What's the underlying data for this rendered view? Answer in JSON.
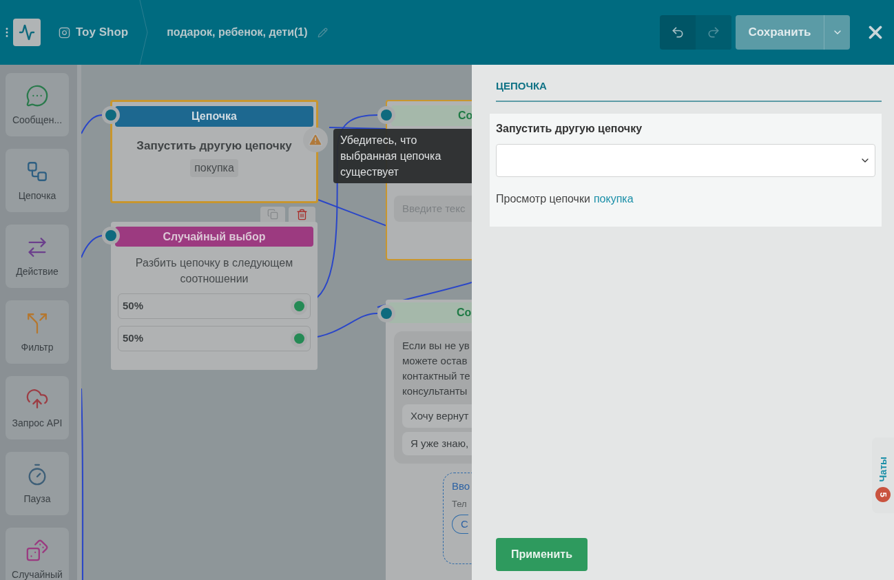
{
  "header": {
    "account": "Toy Shop",
    "flow_title": "подарок, ребенок, дети(1)",
    "save_label": "Сохранить"
  },
  "palette": [
    {
      "label": "Сообщен...",
      "kind": "message"
    },
    {
      "label": "Цепочка",
      "kind": "chain"
    },
    {
      "label": "Действие",
      "kind": "action"
    },
    {
      "label": "Фильтр",
      "kind": "filter"
    },
    {
      "label": "Запрос API",
      "kind": "api"
    },
    {
      "label": "Пауза",
      "kind": "pause"
    },
    {
      "label": "Случайный",
      "kind": "random"
    }
  ],
  "chain_node": {
    "title": "Цепочка",
    "subtitle": "Запустить другую цепочку",
    "tag": "покупка",
    "warning": true
  },
  "random_node": {
    "title": "Случайный выбор",
    "description": "Разбить цепочку в следующем соотношении",
    "branches": [
      {
        "label": "50%"
      },
      {
        "label": "50%"
      }
    ]
  },
  "message_nodes": [
    {
      "title": "Со",
      "input_placeholder": "Введите текс"
    },
    {
      "title": "Со",
      "text_lines": [
        "Если вы не ув",
        "можете остав",
        "контактный те",
        "консультанты"
      ],
      "buttons": [
        "Хочу вернут",
        "Я уже знаю,"
      ],
      "input_block": {
        "title": "Вво",
        "label": "Тел",
        "button": "С"
      }
    }
  ],
  "tooltip": "Убедитесь, что выбранная цепочка существует",
  "panel": {
    "title": "ЦЕПОЧКА",
    "field_label": "Запустить другую цепочку",
    "view_prefix": "Просмотр цепочки",
    "view_link": "покупка",
    "apply": "Применить"
  },
  "chats": {
    "label": "Чаты",
    "count": "5"
  }
}
